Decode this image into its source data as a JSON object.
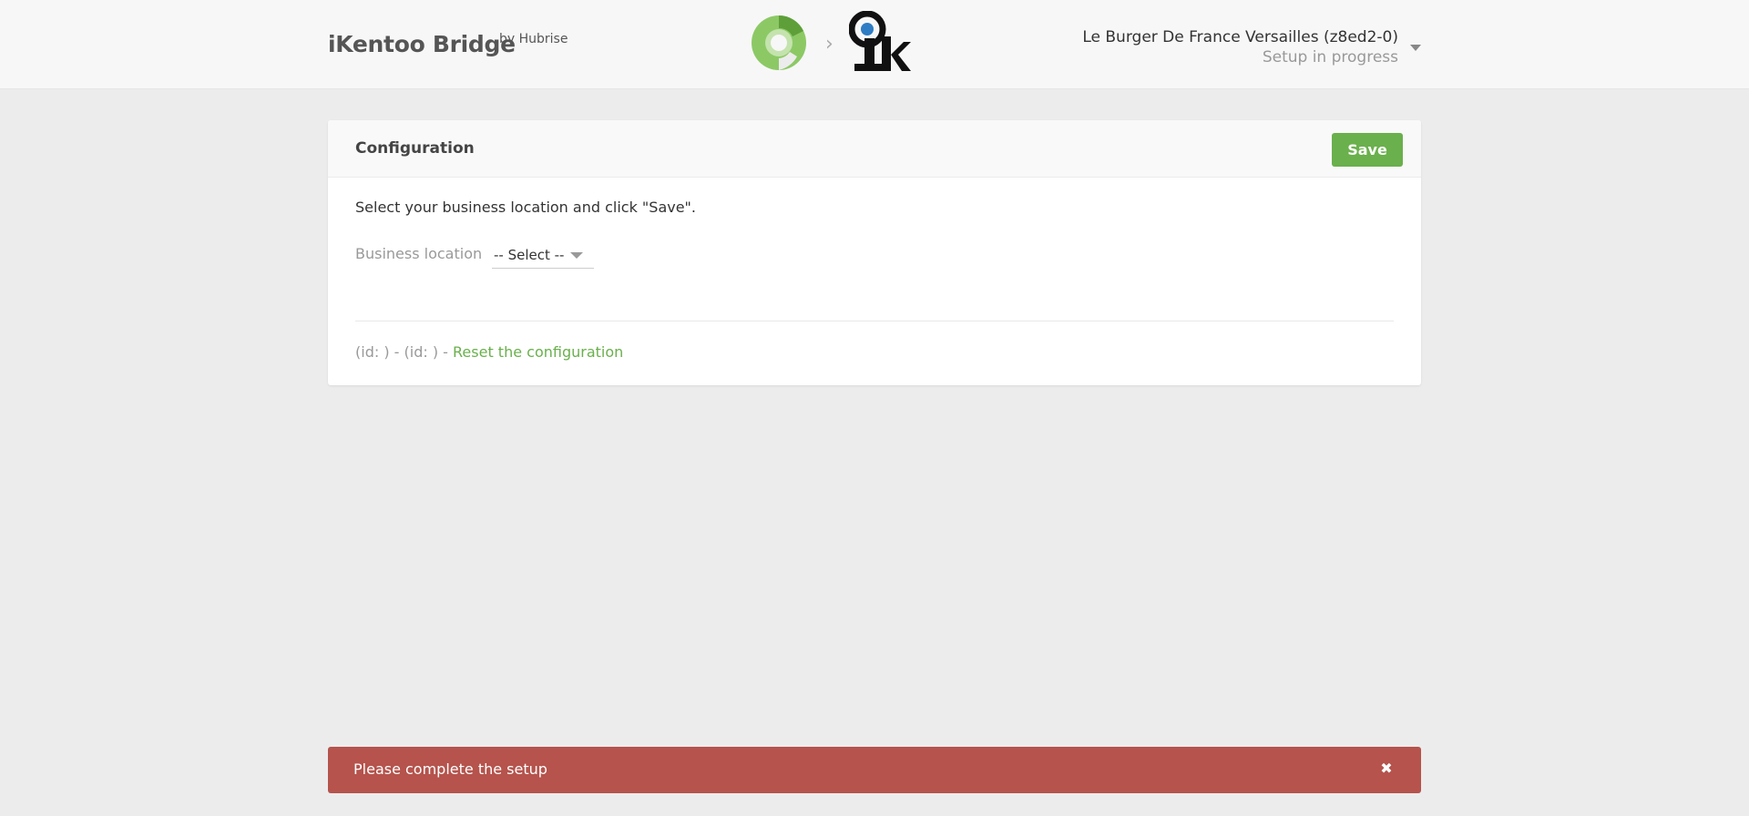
{
  "header": {
    "app_title": "iKentoo Bridge",
    "app_by": "by Hubrise",
    "logos": [
      "hubrise-logo-icon",
      "chevron-right-icon",
      "ikentoo-logo-icon"
    ],
    "chevron": "›",
    "account_name": "Le Burger De France Versailles (z8ed2-0)",
    "account_status": "Setup in progress"
  },
  "card": {
    "title": "Configuration",
    "save_label": "Save",
    "instructions": "Select your business location and click \"Save\".",
    "field_label": "Business location",
    "select_value": "-- Select --",
    "footer_prefix": "(id: ) - (id: ) - ",
    "reset_label": "Reset the configuration"
  },
  "alert": {
    "text": "Please complete the setup",
    "close_glyph": "✖"
  },
  "colors": {
    "accent_green": "#6ab04c",
    "alert_red": "#b5534c",
    "background": "#ececec"
  }
}
